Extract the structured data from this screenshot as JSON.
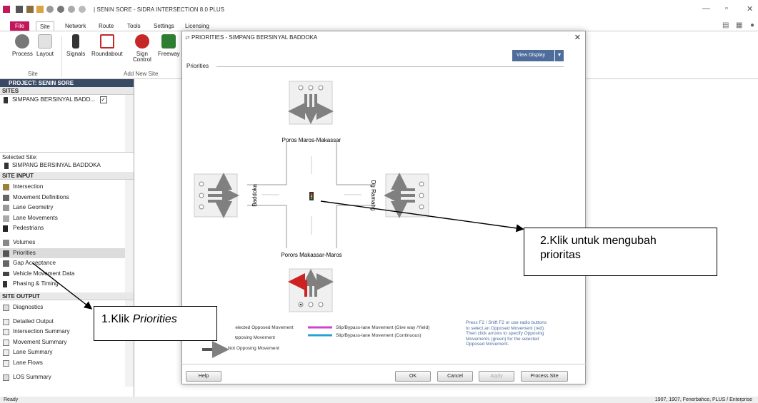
{
  "window": {
    "title": "SENIN SORE - SIDRA INTERSECTION 8.0 PLUS",
    "controls": [
      "—",
      "▫",
      "✕"
    ]
  },
  "ribbon": {
    "tabs": [
      "File",
      "Site",
      "Network",
      "Route",
      "Tools",
      "Settings",
      "Licensing"
    ],
    "buttons": {
      "process": "Process",
      "layout": "Layout",
      "signals": "Signals",
      "roundabout": "Roundabout",
      "sign_control_1": "Sign",
      "sign_control_2": "Control",
      "freeway": "Freeway"
    },
    "groups": {
      "site": "Site",
      "add_new_site": "Add New Site"
    }
  },
  "left_panel": {
    "project_header": "PROJECT: SENIN SORE",
    "sites_header": "SITES",
    "site_item": "SIMPANG BERSINYAL BADD...",
    "selected_site_label": "Selected Site:",
    "selected_site_value": "SIMPANG BERSINYAL BADDOKA",
    "site_input_header": "SITE INPUT",
    "site_input_items": [
      "Intersection",
      "Movement Definitions",
      "Lane Geometry",
      "Lane Movements",
      "Pedestrians",
      "Volumes",
      "Priorities",
      "Gap Acceptance",
      "Vehicle Movement Data",
      "Phasing & Timing"
    ],
    "site_output_header": "SITE OUTPUT",
    "site_output_items": [
      "Diagnostics",
      "Detailed Output",
      "Intersection Summary",
      "Movement Summary",
      "Lane Summary",
      "Lane Flows",
      "LOS Summary"
    ]
  },
  "status": {
    "left": "Ready",
    "right": "1907, 1907, Fenerbahce, PLUS / Enterprise"
  },
  "dialog": {
    "title": "PRIORITIES - SIMPANG BERSINYAL BADDOKA",
    "view_display": "View Display",
    "section_label": "Priorities",
    "roads": {
      "north": "Poros  Maros-Makassar",
      "south": "Porors Makassar-Maros",
      "west": "Baddoka",
      "east": "Dg Ramang"
    },
    "legend": {
      "selected_opposed": "Selected Opposed Movement",
      "opposing": "Opposing Movement",
      "not_opposing": "Not Opposing Movement",
      "slip_yield": "Slip/Bypass-lane Movement (Give way /Yield)",
      "slip_continuous": "Slip/Bypass-lane Movement (Continuous)",
      "help_text": [
        "Press F2 / Shift F2 or use radio buttons",
        "to select an Opposed Movement (red).",
        "Then click arrows to specify Opposing",
        "Movements (green) for the selected",
        "Opposed Movement."
      ]
    },
    "buttons": {
      "help": "Help",
      "ok": "OK",
      "cancel": "Cancel",
      "apply": "Apply",
      "process_site": "Process Site"
    }
  },
  "annotations": {
    "step1_prefix": "1.Klik ",
    "step1_italic": "Priorities",
    "step2_line1": "2.Klik  untuk  mengubah",
    "step2_line2": "prioritas"
  },
  "colors": {
    "file_tab": "#c2185b",
    "project_header": "#394a64",
    "view_display_button": "#4f6d9c",
    "selected_opposed": "#cc2222",
    "arrow_gray": "#808080"
  }
}
